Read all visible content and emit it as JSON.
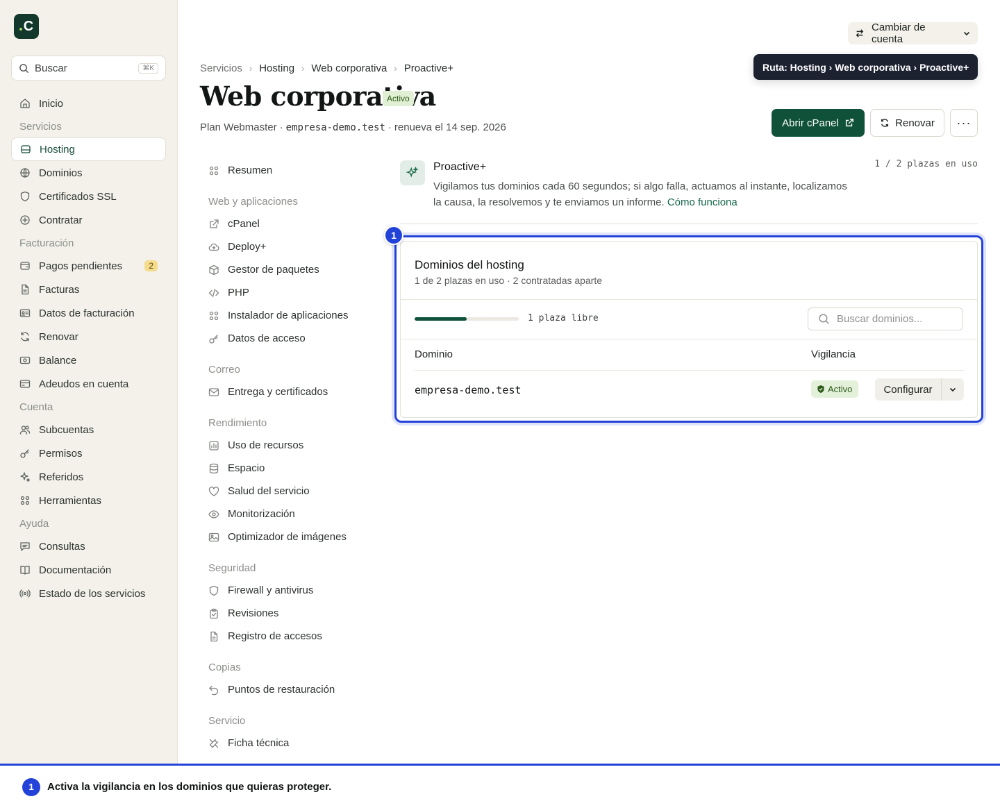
{
  "app": {
    "logo_letter": "C",
    "accent": "#0f5139",
    "highlight_color": "#2343d8"
  },
  "sidebar": {
    "search": {
      "placeholder": "Buscar",
      "shortcut": "⌘K"
    },
    "items": [
      {
        "type": "item",
        "label": "Inicio",
        "icon": "home-icon"
      },
      {
        "type": "section",
        "label": "Servicios"
      },
      {
        "type": "item",
        "label": "Hosting",
        "icon": "server-icon",
        "active": true
      },
      {
        "type": "item",
        "label": "Dominios",
        "icon": "globe-icon"
      },
      {
        "type": "item",
        "label": "Certificados SSL",
        "icon": "shield-icon"
      },
      {
        "type": "item",
        "label": "Contratar",
        "icon": "plus-circle-icon"
      },
      {
        "type": "section",
        "label": "Facturación"
      },
      {
        "type": "item",
        "label": "Pagos pendientes",
        "icon": "wallet-icon",
        "badge": "2"
      },
      {
        "type": "item",
        "label": "Facturas",
        "icon": "file-icon"
      },
      {
        "type": "item",
        "label": "Datos de facturación",
        "icon": "id-card-icon"
      },
      {
        "type": "item",
        "label": "Renovar",
        "icon": "refresh-icon"
      },
      {
        "type": "item",
        "label": "Balance",
        "icon": "banknote-icon"
      },
      {
        "type": "item",
        "label": "Adeudos en cuenta",
        "icon": "credit-card-icon"
      },
      {
        "type": "section",
        "label": "Cuenta"
      },
      {
        "type": "item",
        "label": "Subcuentas",
        "icon": "users-icon"
      },
      {
        "type": "item",
        "label": "Permisos",
        "icon": "key-icon"
      },
      {
        "type": "item",
        "label": "Referidos",
        "icon": "sparkles-icon"
      },
      {
        "type": "item",
        "label": "Herramientas",
        "icon": "grid-icon"
      },
      {
        "type": "section",
        "label": "Ayuda"
      },
      {
        "type": "item",
        "label": "Consultas",
        "icon": "chat-icon"
      },
      {
        "type": "item",
        "label": "Documentación",
        "icon": "book-icon"
      },
      {
        "type": "item",
        "label": "Estado de los servicios",
        "icon": "broadcast-icon"
      }
    ]
  },
  "topbar": {
    "account_switch_label": "Cambiar de cuenta",
    "tooltip": "Ruta: Hosting › Web corporativa › Proactive+"
  },
  "breadcrumb": [
    "Servicios",
    "Hosting",
    "Web corporativa",
    "Proactive+"
  ],
  "header": {
    "title": "Web corporativa",
    "status_badge": "Activo",
    "plan": "Plan Webmaster",
    "domain": "empresa-demo.test",
    "renewal": "renueva el 14 sep. 2026",
    "separator": "·",
    "open_cpanel_label": "Abrir cPanel",
    "renew_label": "Renovar",
    "more_label": "···"
  },
  "subnav": [
    {
      "type": "item",
      "label": "Resumen",
      "icon": "grid-icon"
    },
    {
      "type": "section",
      "label": "Web y aplicaciones"
    },
    {
      "type": "item",
      "label": "cPanel",
      "icon": "external-link-icon"
    },
    {
      "type": "item",
      "label": "Deploy+",
      "icon": "cloud-upload-icon"
    },
    {
      "type": "item",
      "label": "Gestor de paquetes",
      "icon": "package-icon"
    },
    {
      "type": "item",
      "label": "PHP",
      "icon": "code-icon"
    },
    {
      "type": "item",
      "label": "Instalador de aplicaciones",
      "icon": "grid-icon"
    },
    {
      "type": "item",
      "label": "Datos de acceso",
      "icon": "key-icon"
    },
    {
      "type": "section",
      "label": "Correo"
    },
    {
      "type": "item",
      "label": "Entrega y certificados",
      "icon": "mail-icon"
    },
    {
      "type": "section",
      "label": "Rendimiento"
    },
    {
      "type": "item",
      "label": "Uso de recursos",
      "icon": "chart-icon"
    },
    {
      "type": "item",
      "label": "Espacio",
      "icon": "database-icon"
    },
    {
      "type": "item",
      "label": "Salud del servicio",
      "icon": "heart-icon"
    },
    {
      "type": "item",
      "label": "Monitorización",
      "icon": "eye-icon"
    },
    {
      "type": "item",
      "label": "Optimizador de imágenes",
      "icon": "image-icon"
    },
    {
      "type": "section",
      "label": "Seguridad"
    },
    {
      "type": "item",
      "label": "Firewall y antivirus",
      "icon": "shield-icon"
    },
    {
      "type": "item",
      "label": "Revisiones",
      "icon": "clipboard-icon"
    },
    {
      "type": "item",
      "label": "Registro de accesos",
      "icon": "file-icon"
    },
    {
      "type": "section",
      "label": "Copias"
    },
    {
      "type": "item",
      "label": "Puntos de restauración",
      "icon": "undo-icon"
    },
    {
      "type": "section",
      "label": "Servicio"
    },
    {
      "type": "item",
      "label": "Ficha técnica",
      "icon": "tools-icon"
    }
  ],
  "proactive": {
    "title": "Proactive+",
    "description": "Vigilamos tus dominios cada 60 segundos; si algo falla, actuamos al instante, localizamos la causa, la resolvemos y te enviamos un informe.",
    "link": "Cómo funciona",
    "seats": "1 / 2 plazas en uso"
  },
  "domains_card": {
    "marker": "1",
    "title": "Dominios del hosting",
    "subtitle": "1 de 2 plazas en uso · 2 contratadas aparte",
    "progress_fraction": 0.5,
    "progress_label": "1 plaza libre",
    "search_placeholder": "Buscar dominios...",
    "columns": [
      "Dominio",
      "Vigilancia"
    ],
    "rows": [
      {
        "domain": "empresa-demo.test",
        "status": "Activo",
        "action": "Configurar"
      }
    ]
  },
  "banner": {
    "number": "1",
    "text": "Activa la vigilancia en los dominios que quieras proteger."
  }
}
